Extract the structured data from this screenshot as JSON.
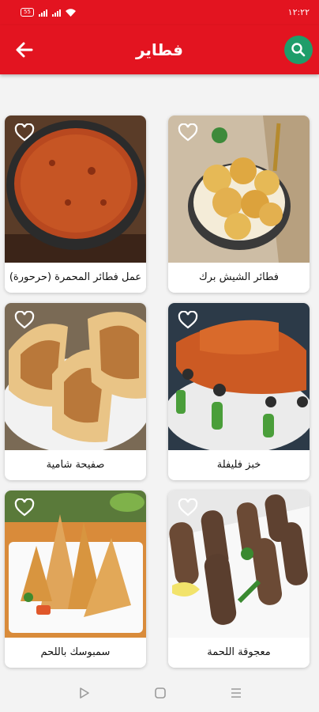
{
  "status_bar": {
    "time": "١٢:٢٢",
    "battery_level": "55"
  },
  "app_bar": {
    "title": "فطاير"
  },
  "icons": {
    "back": "arrow-left-icon",
    "search": "search-icon",
    "favorite": "heart-outline-icon"
  },
  "colors": {
    "primary": "#e31420",
    "search_button": "#1f9d6a"
  },
  "recipes": [
    {
      "name": "فطائر الشيش برك"
    },
    {
      "name": "عمل فطائر المحمرة (حرحورة)"
    },
    {
      "name": "خبز فليفلة"
    },
    {
      "name": "صفيحة شامية"
    },
    {
      "name": "معجوقة اللحمة"
    },
    {
      "name": "سمبوسك باللحم"
    }
  ]
}
